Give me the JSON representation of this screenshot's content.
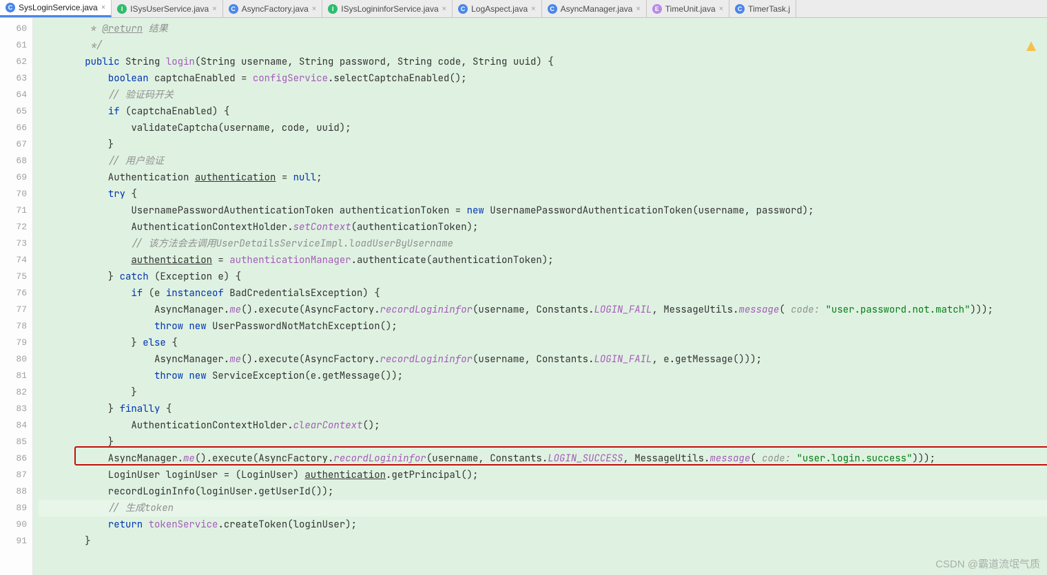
{
  "tabs": [
    {
      "type": "c",
      "label": "SysLoginService.java",
      "active": true
    },
    {
      "type": "i",
      "label": "ISysUserService.java"
    },
    {
      "type": "c",
      "label": "AsyncFactory.java"
    },
    {
      "type": "i",
      "label": "ISysLogininforService.java"
    },
    {
      "type": "c",
      "label": "LogAspect.java"
    },
    {
      "type": "c",
      "label": "AsyncManager.java"
    },
    {
      "type": "e",
      "label": "TimeUnit.java"
    },
    {
      "type": "c",
      "label": "TimerTask.j"
    }
  ],
  "lineStart": 60,
  "lineEnd": 91,
  "code": {
    "c0": "         * ",
    "c0r": "@return",
    "c0s": " 结果",
    "c1": "         */",
    "c2a": "        ",
    "kwpub": "public",
    "sp": " ",
    "tyStr": "String ",
    "fnLogin": "login",
    "c2b": "(String username, String password, String code, String uuid) {",
    "c3a": "            ",
    "kwbool": "boolean",
    "c3b": " captchaEnabled = ",
    "cfg": "configService",
    "c3c": ".selectCaptchaEnabled();",
    "c4": "            // 验证码开关",
    "c5a": "            ",
    "kwif": "if",
    "c5b": " (captchaEnabled) {",
    "c6": "                validateCaptcha(username, code, uuid);",
    "c7": "            }",
    "c8": "            // 用户验证",
    "c9a": "            Authentication ",
    "auth": "authentication",
    "c9b": " = ",
    "kwnull": "null",
    "semi": ";",
    "c10a": "            ",
    "kwtry": "try",
    "c10b": " {",
    "c11a": "                UsernamePasswordAuthenticationToken authenticationToken = ",
    "kwnew": "new",
    "c11b": " UsernamePasswordAuthenticationToken(username, password);",
    "c12a": "                AuthenticationContextHolder.",
    "setCtx": "setContext",
    "c12b": "(authenticationToken);",
    "c13": "                // 该方法会去调用UserDetailsServiceImpl.loadUserByUsername",
    "c14a": "                ",
    "auth2": "authentication",
    "c14b": " = ",
    "authMgr": "authenticationManager",
    "c14c": ".authenticate(authenticationToken);",
    "c15a": "            } ",
    "kwcatch": "catch",
    "c15b": " (Exception e) {",
    "c16a": "                ",
    "kwif2": "if",
    "c16b": " (e ",
    "kwio": "instanceof",
    "c16c": " BadCredentialsException) {",
    "c17a": "                    AsyncManager.",
    "me": "me",
    "c17b": "().execute(AsyncFactory.",
    "rec": "recordLogininfor",
    "c17c": "(username, Constants.",
    "lf": "LOGIN_FAIL",
    "c17d": ", MessageUtils.",
    "msg": "message",
    "c17e": "( ",
    "hint1": "code:",
    "c17f": " ",
    "str1": "\"user.password.not.match\"",
    "c17g": ")));",
    "c18a": "                    ",
    "kwthrow": "throw",
    "c18b": " ",
    "kwnew2": "new",
    "c18c": " UserPasswordNotMatchException();",
    "c19a": "                } ",
    "kwelse": "else",
    "c19b": " {",
    "c20a": "                    AsyncManager.",
    "me2": "me",
    "c20b": "().execute(AsyncFactory.",
    "rec2": "recordLogininfor",
    "c20c": "(username, Constants.",
    "lf2": "LOGIN_FAIL",
    "c20d": ", e.getMessage()));",
    "c21a": "                    ",
    "kwthrow2": "throw",
    "c21b": " ",
    "kwnew3": "new",
    "c21c": " ServiceException(e.getMessage());",
    "c22": "                }",
    "c23a": "            } ",
    "kwfin": "finally",
    "c23b": " {",
    "c24a": "                AuthenticationContextHolder.",
    "clr": "clearContext",
    "c24b": "();",
    "c25": "            }",
    "c26a": "            AsyncManager.",
    "me3": "me",
    "c26b": "().execute(AsyncFactory.",
    "rec3": "recordLogininfor",
    "c26c": "(username, Constants.",
    "ls": "LOGIN_SUCCESS",
    "c26d": ", MessageUtils.",
    "msg2": "message",
    "c26e": "( ",
    "hint2": "code:",
    "c26f": " ",
    "str2": "\"user.login.success\"",
    "c26g": ")));",
    "c27a": "            LoginUser loginUser = (LoginUser) ",
    "auth3": "authentication",
    "c27b": ".getPrincipal();",
    "c28": "            recordLoginInfo(loginUser.getUserId());",
    "c29": "            // 生成token",
    "c30a": "            ",
    "kwret": "return",
    "c30b": " ",
    "tok": "tokenService",
    "c30c": ".createToken(loginUser);",
    "c31": "        }"
  },
  "watermark": "CSDN @霸道流氓气质"
}
